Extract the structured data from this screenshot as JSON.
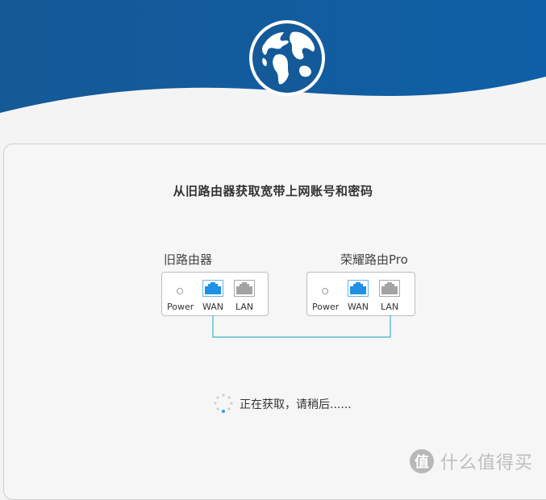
{
  "page": {
    "title": "从旧路由器获取宽带上网账号和密码",
    "status_text": "正在获取，请稍后......"
  },
  "old_router": {
    "label": "旧路由器",
    "power_label": "Power",
    "wan_label": "WAN",
    "lan_label": "LAN"
  },
  "new_router": {
    "label": "荣耀路由Pro",
    "power_label": "Power",
    "wan_label": "WAN",
    "lan_label": "LAN"
  },
  "watermark": {
    "text": "什么值得买",
    "logo_char": "值"
  },
  "colors": {
    "header_blue": "#0f5aa0",
    "wan_port_blue": "#1e90e6",
    "lan_port_gray": "#a3a3a3",
    "cable_teal": "#3bb3c7"
  },
  "icons": [
    "globe-icon",
    "spinner-icon",
    "ethernet-port-icon",
    "power-dot-icon"
  ]
}
